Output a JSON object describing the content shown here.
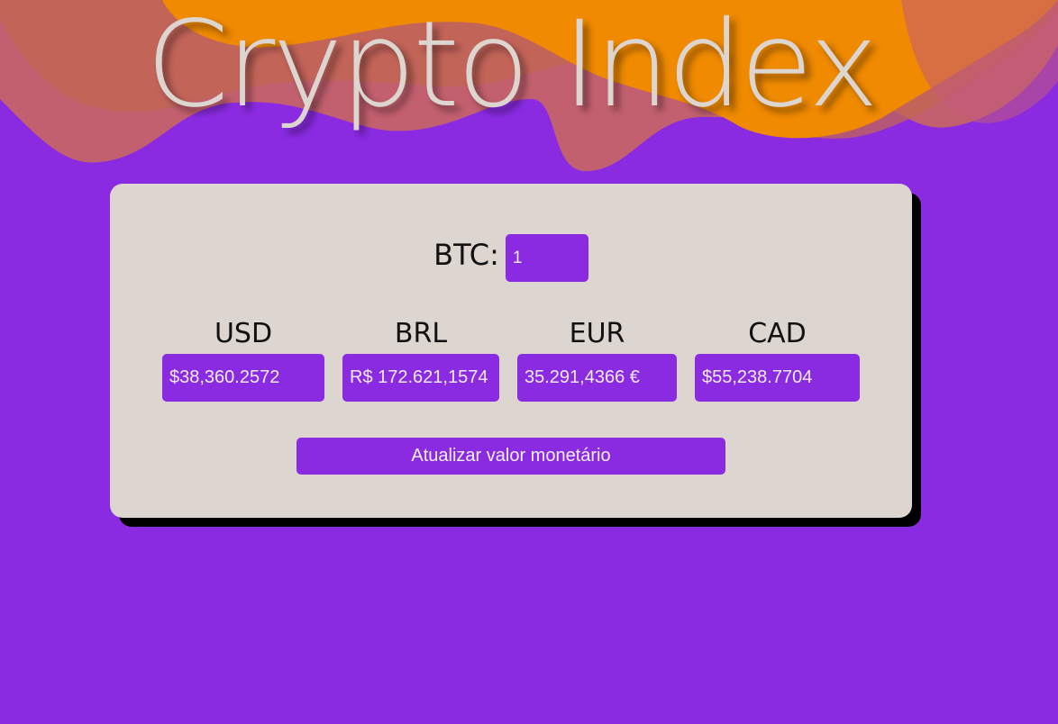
{
  "header": {
    "title": "Crypto Index"
  },
  "converter": {
    "btc_label": "BTC:",
    "btc_value": "1",
    "currencies": [
      {
        "code": "USD",
        "value": "$38,360.2572"
      },
      {
        "code": "BRL",
        "value": "R$ 172.621,1574"
      },
      {
        "code": "EUR",
        "value": "35.291,4366 €"
      },
      {
        "code": "CAD",
        "value": "$55,238.7704"
      }
    ],
    "update_button_label": "Atualizar valor monetário"
  },
  "colors": {
    "background": "#8a2be2",
    "wave_orange": "#f08a00",
    "wave_rose": "#cc6a5a",
    "card": "#ddd5d0",
    "field": "#8a2be2"
  }
}
